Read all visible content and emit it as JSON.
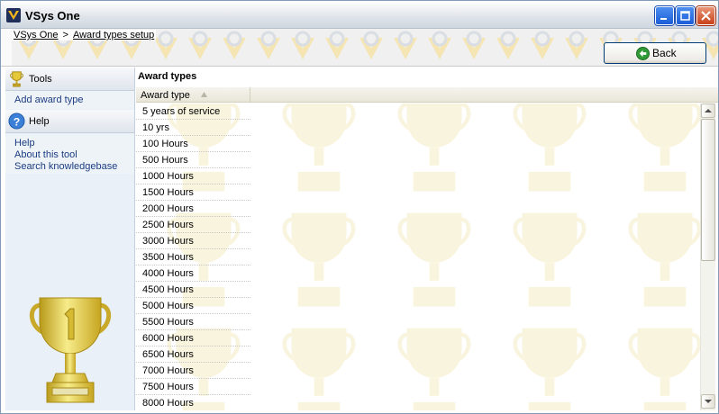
{
  "window": {
    "title": "VSys One"
  },
  "breadcrumb": {
    "home": "VSys One",
    "separator": ">",
    "current": "Award types setup"
  },
  "toolbar": {
    "back_label": "Back"
  },
  "sidebar": {
    "tools_label": "Tools",
    "tools_items": [
      "Add award type"
    ],
    "help_label": "Help",
    "help_items": [
      "Help",
      "About this tool",
      "Search knowledgebase"
    ]
  },
  "main": {
    "title": "Award types",
    "column_header": "Award type",
    "rows": [
      "5 years of service",
      "10 yrs",
      "100 Hours",
      "500 Hours",
      "1000 Hours",
      "1500 Hours",
      "2000 Hours",
      "2500 Hours",
      "3000 Hours",
      "3500 Hours",
      "4000 Hours",
      "4500 Hours",
      "5000 Hours",
      "5500 Hours",
      "6000 Hours",
      "6500 Hours",
      "7000 Hours",
      "7500 Hours",
      "8000 Hours"
    ]
  },
  "icons": {
    "app": "vsys-logo-icon",
    "minimize": "minimize-icon",
    "maximize": "maximize-icon",
    "close": "close-icon",
    "back": "back-arrow-icon",
    "tools": "trophy-icon",
    "help": "help-icon",
    "sort": "sort-ascending-icon"
  },
  "colors": {
    "link": "#1b3c82",
    "sidebar_bg": "#eaf0f7",
    "header_bg": "#ece9d8",
    "trophy": "#e6c93a"
  }
}
